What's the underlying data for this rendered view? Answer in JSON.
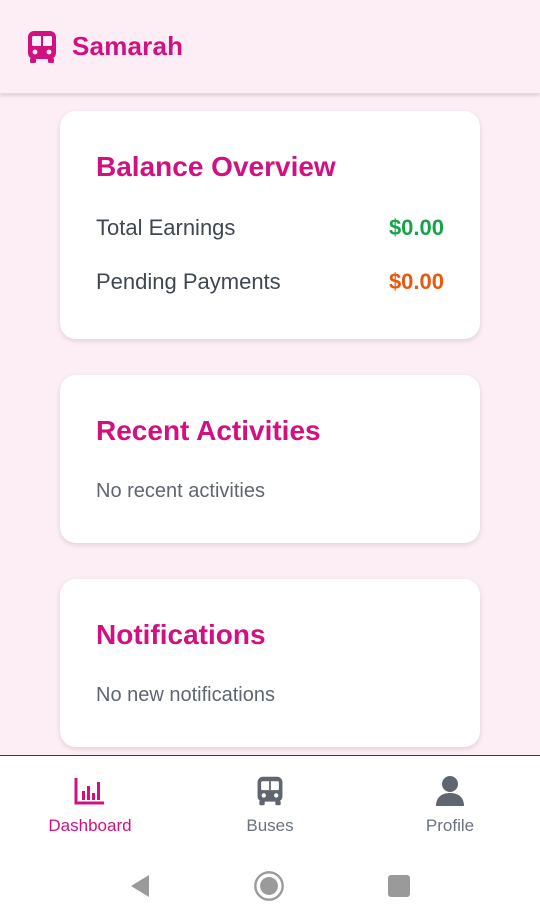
{
  "app": {
    "title": "Samarah",
    "icon": "bus-icon",
    "accent": "#d1117f"
  },
  "balance": {
    "title": "Balance Overview",
    "rows": [
      {
        "label": "Total Earnings",
        "value": "$0.00",
        "color": "#16a34a"
      },
      {
        "label": "Pending Payments",
        "value": "$0.00",
        "color": "#ea580c"
      }
    ]
  },
  "activities": {
    "title": "Recent Activities",
    "empty": "No recent activities"
  },
  "notifications": {
    "title": "Notifications",
    "empty": "No new notifications"
  },
  "bottom_nav": {
    "items": [
      {
        "label": "Dashboard",
        "icon": "bar-chart-icon",
        "active": true
      },
      {
        "label": "Buses",
        "icon": "bus-icon",
        "active": false
      },
      {
        "label": "Profile",
        "icon": "person-icon",
        "active": false
      }
    ]
  },
  "system_nav": {
    "icons": [
      "back-icon",
      "home-icon",
      "recents-icon"
    ]
  }
}
